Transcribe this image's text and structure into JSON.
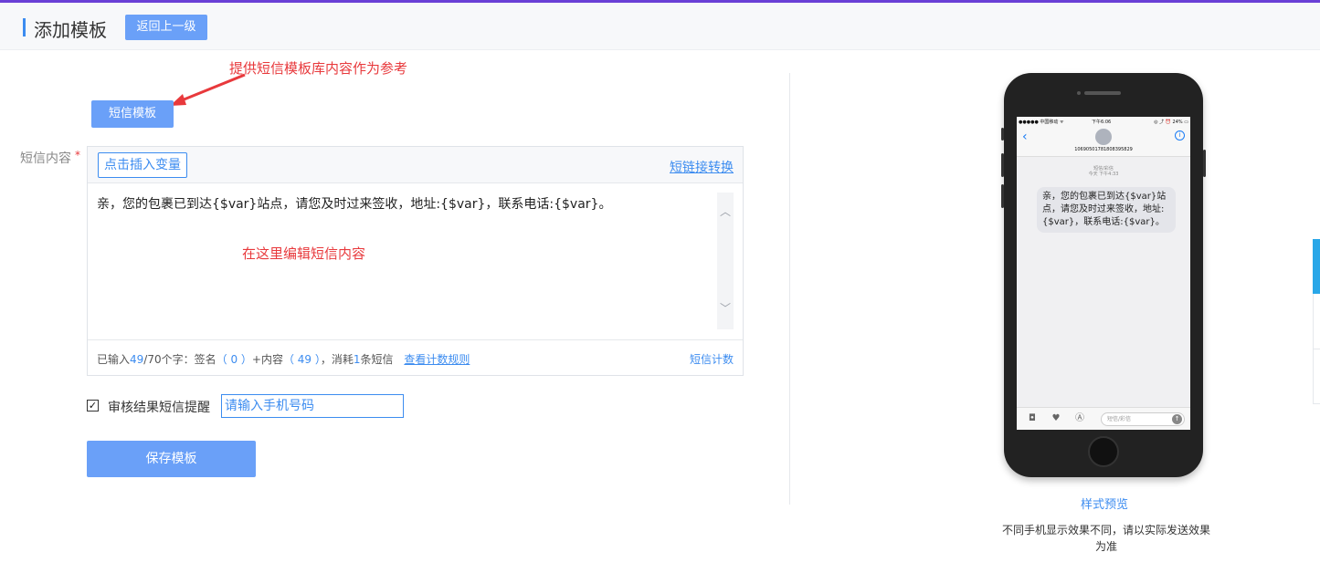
{
  "header": {
    "title": "添加模板",
    "back_label": "返回上一级"
  },
  "annotations": {
    "template_hint": "提供短信模板库内容作为参考",
    "edit_hint": "在这里编辑短信内容"
  },
  "form": {
    "sms_template_button": "短信模板",
    "content_label": "短信内容",
    "required_mark": "*",
    "insert_variable": "点击插入变量",
    "shortlink_convert": "短链接转换",
    "content": "亲，您的包裹已到达{$var}站点，请您及时过来签收，地址:{$var}，联系电话:{$var}。",
    "footer": {
      "typed_prefix": "已输入",
      "typed_count": "49",
      "typed_suffix": "/70个字：签名",
      "sign_count": "（ 0 ）",
      "plus_content": "+内容",
      "content_count": "（ 49 ）",
      "consume_prefix": "，消耗",
      "consume_count": "1",
      "consume_suffix": "条短信",
      "count_rule_link": "查看计数规则",
      "sms_count_link": "短信计数"
    },
    "notify_label": "审核结果短信提醒",
    "notify_checked": true,
    "phone_placeholder": "请输入手机号码",
    "save_button": "保存模板"
  },
  "preview": {
    "status_left": "●●●●● 中国移动 ᯤ",
    "status_time": "下午6:06",
    "status_right": "◎ ⤴ ⏰ 24% ▭",
    "sender_number": "1069050178180839​5829",
    "message_meta_line1": "短信/彩信",
    "message_meta_line2": "今天 下午4:33",
    "bubble_text": "亲，您的包裹已到达{$var}站点，请您及时过来签收，地址:{$var}，联系电话:{$var}。",
    "input_placeholder": "短信/彩信",
    "label": "样式预览",
    "note": "不同手机显示效果不同，请以实际发送效果为准"
  },
  "colors": {
    "accent": "#6aa0f8",
    "link": "#3c8cf0",
    "annotation": "#e8393c",
    "top_strip": "#6a3fd6"
  }
}
